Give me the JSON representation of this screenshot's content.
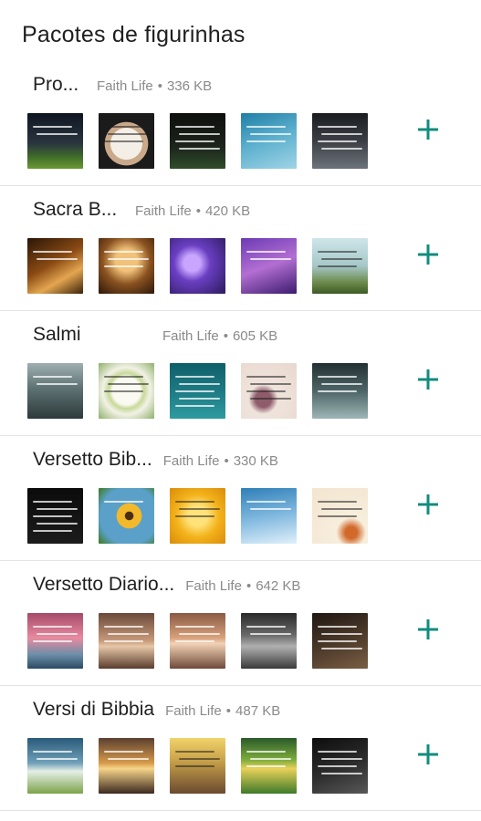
{
  "header": {
    "title": "Pacotes de figurinhas"
  },
  "accent_color": "#128c7e",
  "add_icon": "plus-icon",
  "packs": [
    {
      "name": "Pro...",
      "publisher": "Faith Life",
      "separator": "•",
      "size": "336 KB",
      "stickers": [
        "moon-night-landscape",
        "hands-holding-note",
        "dark-green-quote-card",
        "blue-sky-quote",
        "dark-clouds-quote"
      ]
    },
    {
      "name": "Sacra B...",
      "publisher": "Faith Life",
      "separator": "•",
      "size": "420 KB",
      "stickers": [
        "bible-light-rays",
        "open-bible-warm",
        "purple-flowers",
        "purple-flower-quote",
        "green-field-quote"
      ]
    },
    {
      "name": "Salmi",
      "publisher": "Faith Life",
      "separator": "•",
      "size": "605 KB",
      "stickers": [
        "stormy-sea",
        "daisies-wreath-quote",
        "teal-text-card",
        "pink-rose-quote",
        "mountain-mist-quote"
      ]
    },
    {
      "name": "Versetto Bib...",
      "publisher": "Faith Life",
      "separator": "•",
      "size": "330 KB",
      "stickers": [
        "dark-verse-card",
        "sunflower-blue-sky",
        "yellow-flowers-quote",
        "blue-sky-clouds",
        "starfish-quote"
      ]
    },
    {
      "name": "Versetto Diario...",
      "publisher": "Faith Life",
      "separator": "•",
      "size": "642 KB",
      "stickers": [
        "pink-sunset-sea",
        "brown-sunset-quote",
        "warm-sea-quote",
        "grey-forest-path",
        "dark-brown-quote"
      ]
    },
    {
      "name": "Versi di Bibbia",
      "publisher": "Faith Life",
      "separator": "•",
      "size": "487 KB",
      "stickers": [
        "daisy-field-quote",
        "golden-sunset-text",
        "child-praying-quote",
        "rainbow-field-quote",
        "dark-hand-quote"
      ]
    }
  ]
}
